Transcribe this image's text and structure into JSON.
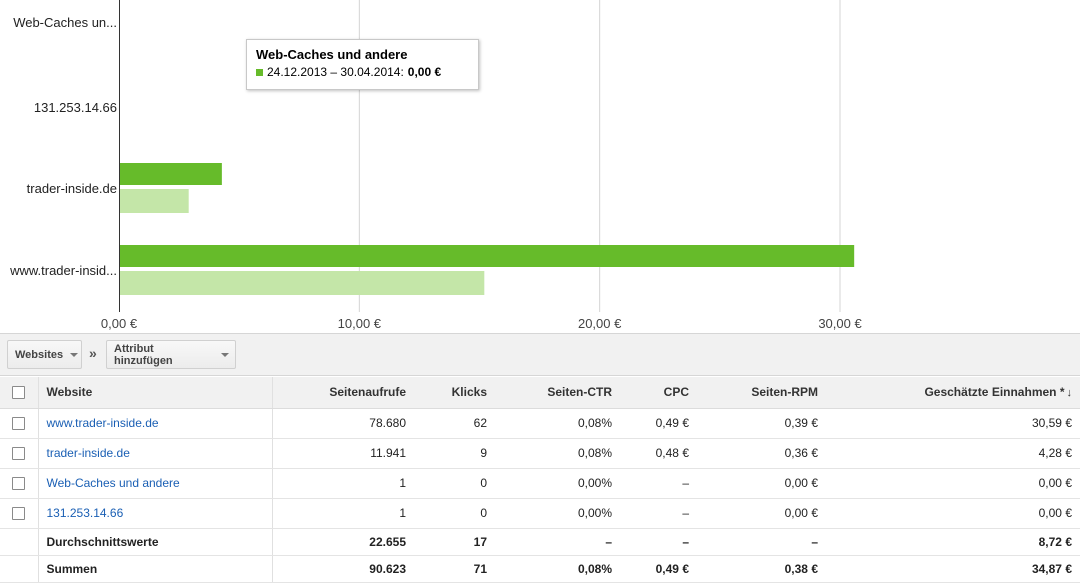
{
  "chart_data": {
    "type": "bar",
    "orientation": "horizontal",
    "categories": [
      "Web-Caches un...",
      "131.253.14.66",
      "trader-inside.de",
      "www.trader-insid..."
    ],
    "series": [
      {
        "values": [
          0.0,
          0.0,
          4.28,
          30.59
        ],
        "color": "#66bb2a"
      },
      {
        "values": [
          0.0,
          0.0,
          2.9,
          15.2
        ],
        "color": "#c4e6a8"
      }
    ],
    "xlim": [
      0,
      40
    ],
    "ticks": [
      0,
      10,
      20,
      30
    ],
    "tick_labels": [
      "0,00 €",
      "10,00 €",
      "20,00 €",
      "30,00 €"
    ],
    "grid": true
  },
  "tooltip": {
    "title": "Web-Caches und andere",
    "range": "24.12.2013 – 30.04.2014:",
    "value": "0,00 €"
  },
  "toolbar": {
    "dimension_label": "Websites",
    "separator": "»",
    "attribute_label": "Attribut hinzufügen"
  },
  "table": {
    "headers": [
      "Website",
      "Seitenaufrufe",
      "Klicks",
      "Seiten-CTR",
      "CPC",
      "Seiten-RPM",
      "Geschätzte Einnahmen *"
    ],
    "sort_indicator": "↓",
    "rows": [
      [
        "www.trader-inside.de",
        "78.680",
        "62",
        "0,08%",
        "0,49 €",
        "0,39 €",
        "30,59 €"
      ],
      [
        "trader-inside.de",
        "11.941",
        "9",
        "0,08%",
        "0,48 €",
        "0,36 €",
        "4,28 €"
      ],
      [
        "Web-Caches und andere",
        "1",
        "0",
        "0,00%",
        "–",
        "0,00 €",
        "0,00 €"
      ],
      [
        "131.253.14.66",
        "1",
        "0",
        "0,00%",
        "–",
        "0,00 €",
        "0,00 €"
      ]
    ],
    "average": [
      "Durchschnittswerte",
      "22.655",
      "17",
      "–",
      "–",
      "–",
      "8,72 €"
    ],
    "totals": [
      "Summen",
      "90.623",
      "71",
      "0,08%",
      "0,49 €",
      "0,38 €",
      "34,87 €"
    ]
  },
  "colors": {
    "bar_primary": "#66bb2a",
    "bar_compare": "#c4e6a8",
    "link": "#1a5fb4"
  }
}
